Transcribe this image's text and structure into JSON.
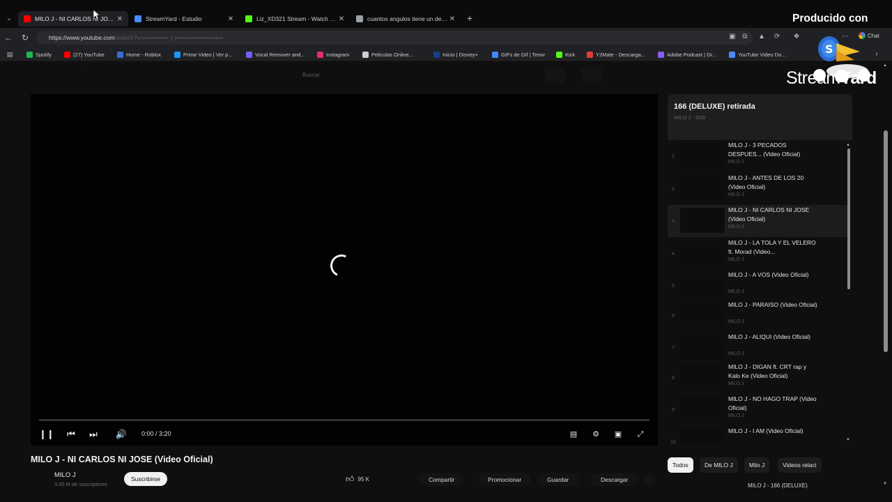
{
  "browser": {
    "tabs": [
      {
        "title": "MILO J - NI CARLOS NI JOSE (Vide",
        "favicon_color": "#ff0000",
        "active": true
      },
      {
        "title": "StreamYard - Estudio",
        "favicon_color": "#4a8cff",
        "active": false
      },
      {
        "title": "Liz_XD321 Stream - Watch Live on",
        "favicon_color": "#53fc18",
        "active": false
      },
      {
        "title": "cuantos angulos tiene un decagon",
        "favicon_color": "#9aa0a6",
        "active": false
      }
    ],
    "address_host": "https://www.youtube.com",
    "address_rest": "/watch?v=•••••••••• | ••••••••••••••••••••",
    "chat_label": "Chat",
    "bookmarks": [
      {
        "label": "Spotify",
        "color": "#1db954"
      },
      {
        "label": "(27) YouTube",
        "color": "#ff0000"
      },
      {
        "label": "Home - Roblox",
        "color": "#3a6bd6"
      },
      {
        "label": "Prime Video | Ver p...",
        "color": "#1a98ff"
      },
      {
        "label": "Vocal Remover and...",
        "color": "#6f62ff"
      },
      {
        "label": "Instagram",
        "color": "#e1306c"
      },
      {
        "label": "Peliculas Online...",
        "color": "#d0d0d0"
      },
      {
        "label": "Inicio | Disney+",
        "color": "#1a3c8f"
      },
      {
        "label": "GIFs de Gif | Tenor",
        "color": "#3e88ff"
      },
      {
        "label": "Kick",
        "color": "#53fc18"
      },
      {
        "label": "Y2Mate - Descarga...",
        "color": "#e53935"
      },
      {
        "label": "Adobe Podcast | Gr...",
        "color": "#8b5cf6"
      },
      {
        "label": "YouTube Video Do...",
        "color": "#4a8cff"
      }
    ]
  },
  "page": {
    "search_placeholder": "Buscar"
  },
  "player": {
    "time": "0:00 / 3:20",
    "progress": 0.0
  },
  "video": {
    "title": "MILO J - NI CARLOS NI JOSE (Video Oficial)",
    "channel": "MILO J",
    "subscribers": "3,65 M de suscriptores",
    "subscribe_label": "Suscribirse",
    "likes": "95 K",
    "actions": [
      "Compartir",
      "Promocionar",
      "Guardar",
      "Descargar"
    ]
  },
  "playlist": {
    "title": "166 (DELUXE) retirada",
    "subtitle": "MILO J - 3/20",
    "items": [
      {
        "index": "1",
        "title": "MILO J - 3 PECADOS DESPUES... (Video Oficial)",
        "channel": "MILO J"
      },
      {
        "index": "2",
        "title": "MILO J - ANTES DE LOS 20 (Video Oficial)",
        "channel": "MILO J"
      },
      {
        "index": "3",
        "title": "MILO J - NI CARLOS NI JOSE (Video Oficial)",
        "channel": "MILO J"
      },
      {
        "index": "4",
        "title": "MILO J - LA TOLA Y EL VELERO ft. Morad (Video...",
        "channel": "MILO J"
      },
      {
        "index": "5",
        "title": "MILO J - A VOS (Video Oficial)",
        "channel": "MILO J"
      },
      {
        "index": "6",
        "title": "MILO J - PARAISO (Video Oficial)",
        "channel": "MILO J"
      },
      {
        "index": "7",
        "title": "MILO J - ALIQUI (Video Oficial)",
        "channel": "MILO J"
      },
      {
        "index": "8",
        "title": "MILO J - DIGAN ft. CRT rap y Kalo Ke (Video Oficial)",
        "channel": "MILO J"
      },
      {
        "index": "9",
        "title": "MILO J - NO HAGO TRAP (Video Oficial)",
        "channel": "MILO J"
      },
      {
        "index": "10",
        "title": "MILO J - I AM (Video Oficial)",
        "channel": "MILO J"
      }
    ]
  },
  "chips": [
    "Todos",
    "De MILO J",
    "Milo J",
    "Videos relaci"
  ],
  "next_up": "MILO J - 166 (DELUXE)",
  "overlay": {
    "produced_by": "Producido con",
    "logo_part1": "Stream",
    "logo_part2": "Yard"
  }
}
